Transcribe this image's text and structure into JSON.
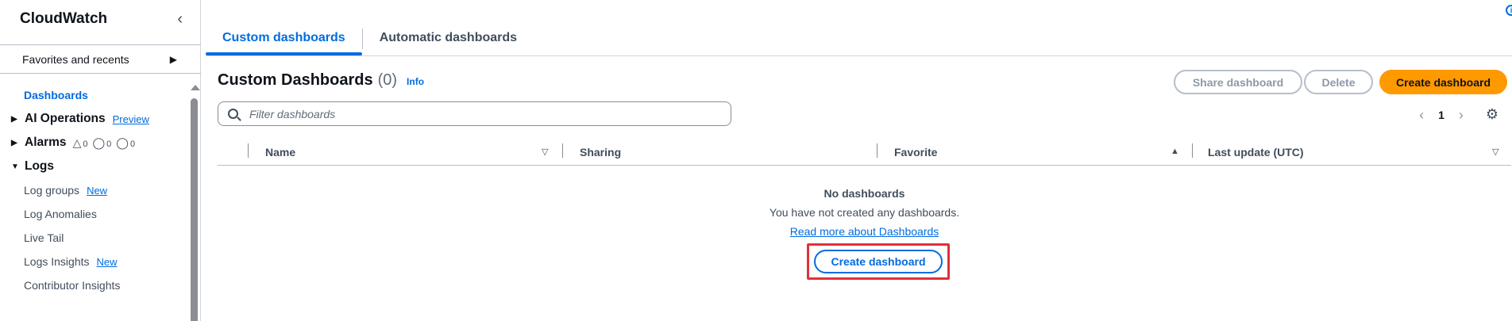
{
  "sidebar": {
    "title": "CloudWatch",
    "collapse_icon": "chevron-left-icon",
    "favorites_label": "Favorites and recents",
    "nav": {
      "dashboards": "Dashboards",
      "ai_operations": "AI Operations",
      "ai_operations_badge": "Preview",
      "alarms": "Alarms",
      "alarm_in_alarm": "0",
      "alarm_ok": "0",
      "alarm_insufficient": "0",
      "logs": "Logs",
      "log_groups": "Log groups",
      "log_groups_badge": "New",
      "log_anomalies": "Log Anomalies",
      "live_tail": "Live Tail",
      "logs_insights": "Logs Insights",
      "logs_insights_badge": "New",
      "contributor_insights": "Contributor Insights"
    }
  },
  "tabs": [
    {
      "label": "Custom dashboards",
      "active": true
    },
    {
      "label": "Automatic dashboards",
      "active": false
    }
  ],
  "header": {
    "title": "Custom Dashboards",
    "count": "(0)",
    "info": "Info"
  },
  "actions": {
    "share": "Share dashboard",
    "delete": "Delete",
    "create": "Create dashboard"
  },
  "filter": {
    "placeholder": "Filter dashboards"
  },
  "pagination": {
    "current_page": "1"
  },
  "table": {
    "columns": [
      "Name",
      "Sharing",
      "Favorite",
      "Last update (UTC)"
    ]
  },
  "empty_state": {
    "title": "No dashboards",
    "description": "You have not created any dashboards.",
    "link": "Read more about Dashboards",
    "button": "Create dashboard"
  },
  "colors": {
    "accent": "#006ce0",
    "primary_button": "#ff9900",
    "highlight_border": "#e0303a"
  }
}
